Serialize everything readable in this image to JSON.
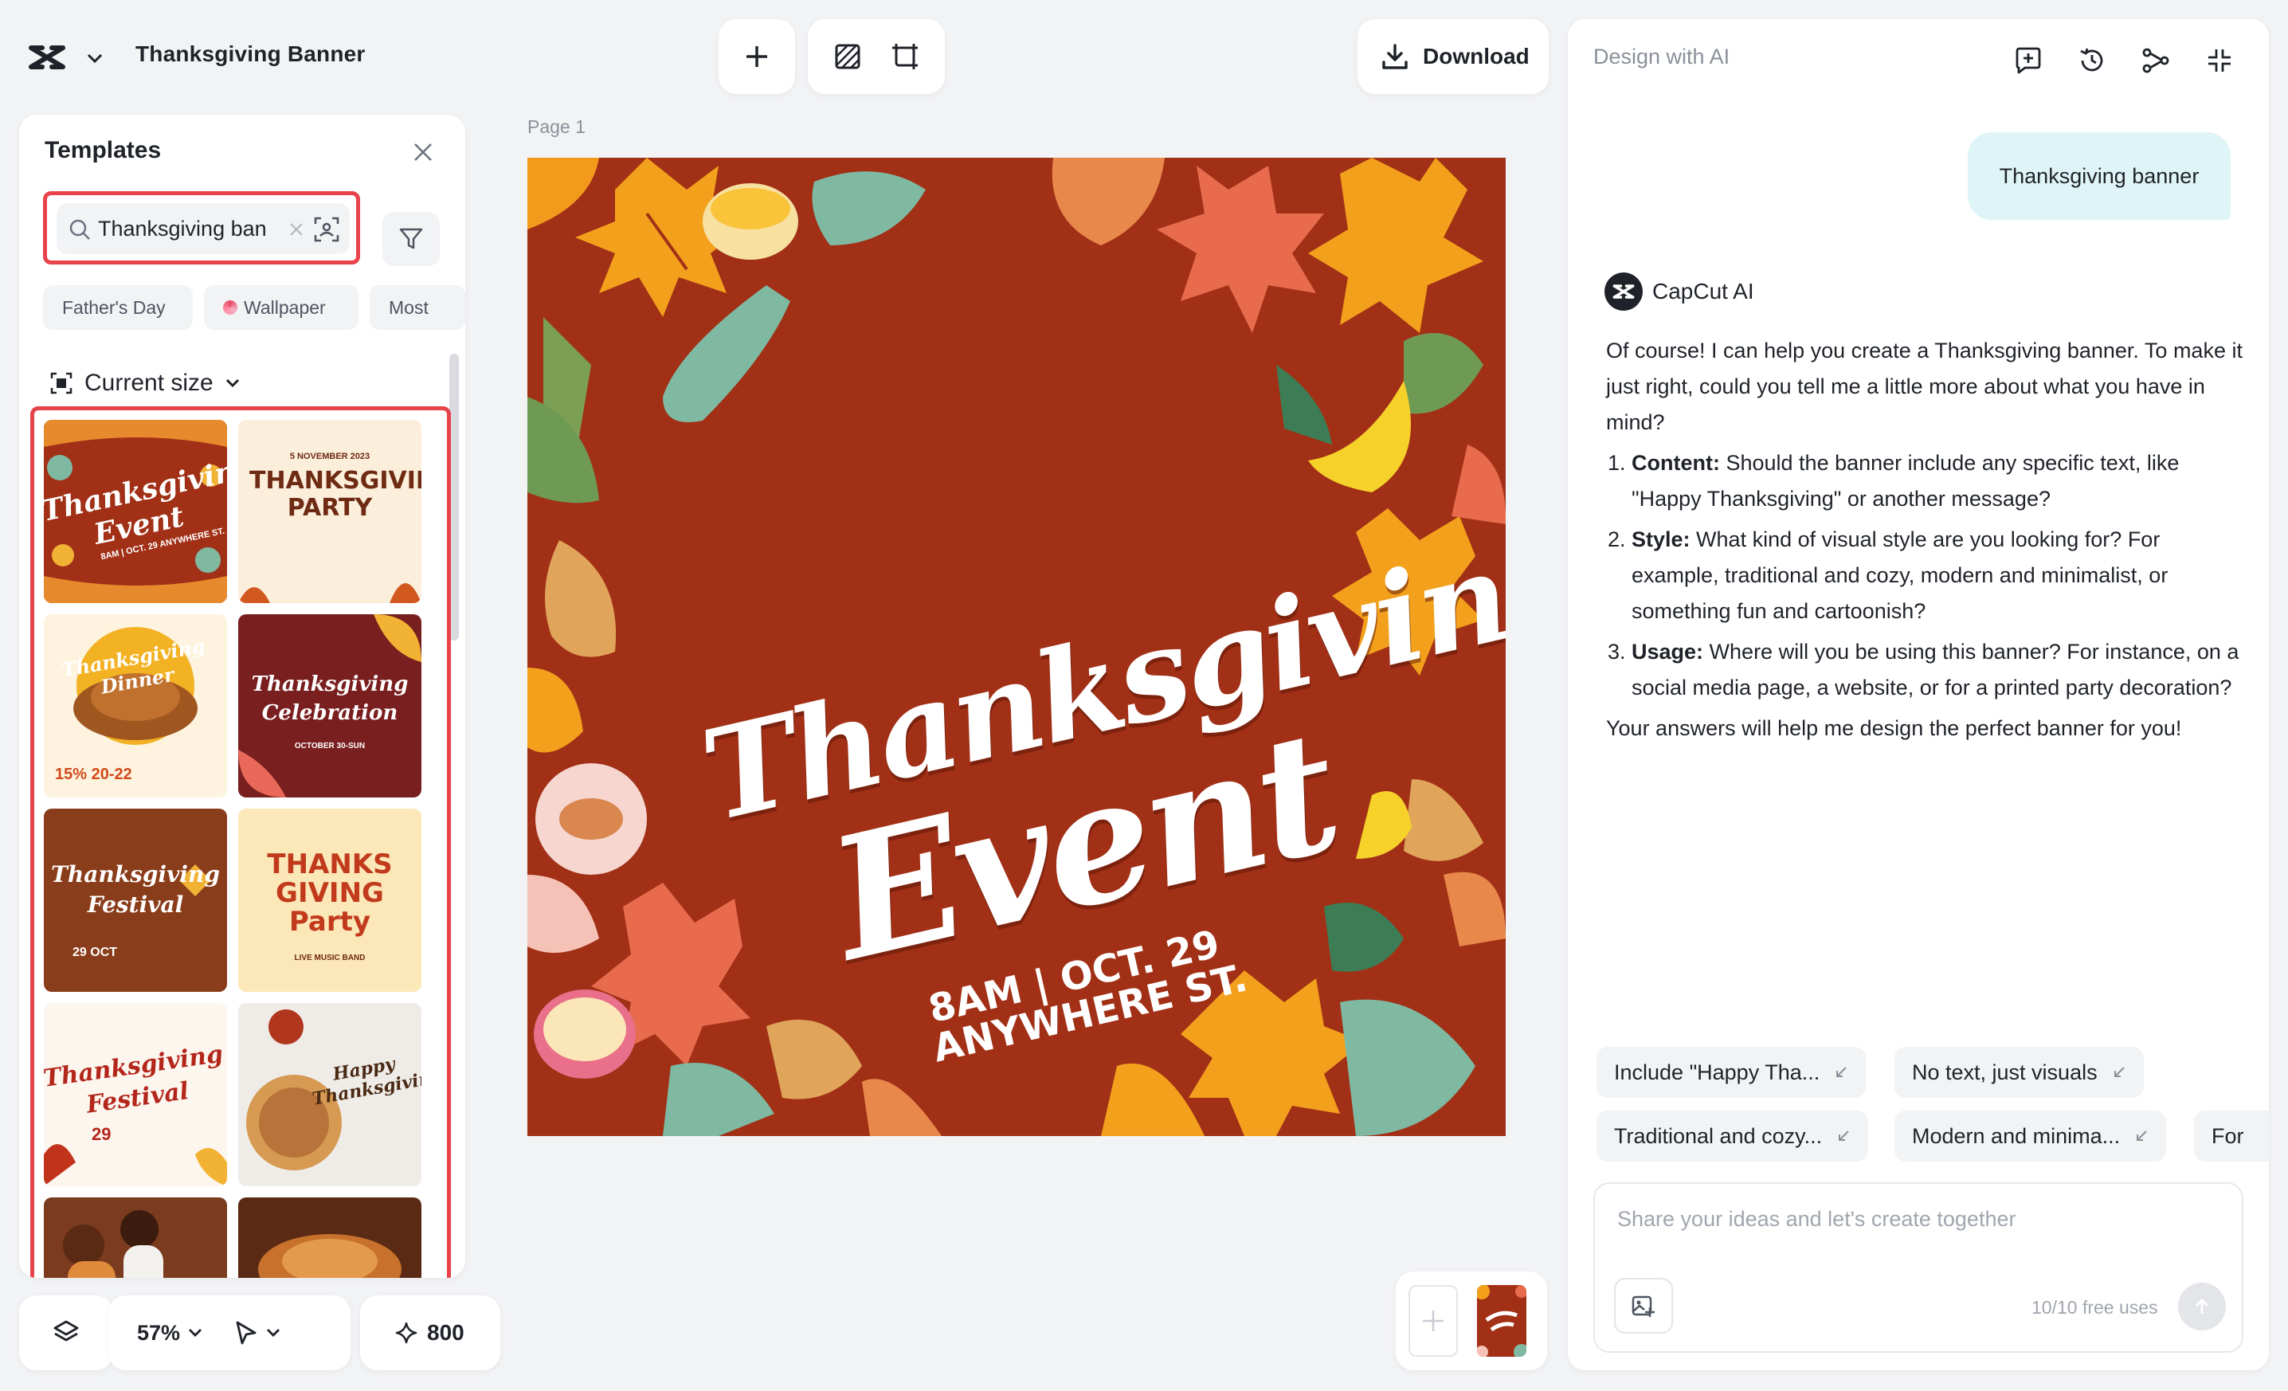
{
  "header": {
    "project_title": "Thanksgiving Banner",
    "download_label": "Download"
  },
  "templates_panel": {
    "title": "Templates",
    "search": {
      "value": "Thanksgiving ban"
    },
    "chips": [
      "Father's Day",
      "Wallpaper",
      "Most"
    ],
    "current_size_label": "Current size",
    "thumbnails": [
      {
        "title": "Thanksgiving Event",
        "sub": "8AM | OCT. 29 ANYWHERE ST.",
        "bg": "#a13016"
      },
      {
        "title": "THANKSGIVING PARTY",
        "sub": "5 NOVEMBER 2023",
        "bg": "#fbeedb"
      },
      {
        "title": "Thanksgiving Dinner",
        "sub": "15% 20-22",
        "bg": "#fdf3df"
      },
      {
        "title": "Thanksgiving Celebration",
        "sub": "OCTOBER 30-SUN",
        "bg": "#7a1f1f"
      },
      {
        "title": "Thanksgiving Festival",
        "sub": "29 OCT",
        "bg": "#8a3d1a"
      },
      {
        "title": "THANKS GIVING Party",
        "sub": "LIVE MUSIC BAND",
        "bg": "#fbe7b8"
      },
      {
        "title": "Thanksgiving Festival",
        "sub": "29",
        "bg": "#fdf6ee"
      },
      {
        "title": "Happy Thanksgiving",
        "sub": "",
        "bg": "#efece8"
      },
      {
        "title": "",
        "sub": "",
        "bg": "#7a3b1e"
      },
      {
        "title": "",
        "sub": "",
        "bg": "#5b2a14"
      }
    ]
  },
  "canvas": {
    "page_label": "Page 1",
    "title_line1": "Thanksgiving",
    "title_line2": "Event",
    "subtitle_line1": "8AM | OCT. 29",
    "subtitle_line2": "ANYWHERE ST.",
    "background_color": "#a13016"
  },
  "bottom_bar": {
    "zoom": "57%",
    "credits": "800"
  },
  "ai_panel": {
    "title": "Design with AI",
    "user_message": "Thanksgiving banner",
    "assistant_name": "CapCut AI",
    "intro": "Of course! I can help you create a Thanksgiving banner. To make it just right, could you tell me a little more about what you have in mind?",
    "questions": [
      {
        "label": "Content:",
        "text": "Should the banner include any specific text, like \"Happy Thanksgiving\" or another message?"
      },
      {
        "label": "Style:",
        "text": "What kind of visual style are you looking for? For example, traditional and cozy, modern and minimalist, or something fun and cartoonish?"
      },
      {
        "label": "Usage:",
        "text": "Where will you be using this banner? For instance, on a social media page, a website, or for a printed party decoration?"
      }
    ],
    "closing": "Your answers will help me design the perfect banner for you!",
    "suggestions": [
      "Include \"Happy Tha...",
      "No text, just visuals",
      "Traditional and cozy...",
      "Modern and minima...",
      "For"
    ],
    "input_placeholder": "Share your ideas and let's create together",
    "free_uses": "10/10 free uses"
  },
  "colors": {
    "accent_red": "#e8434a",
    "canvas_bg": "#a13016",
    "user_bubble": "#dff4f6"
  }
}
